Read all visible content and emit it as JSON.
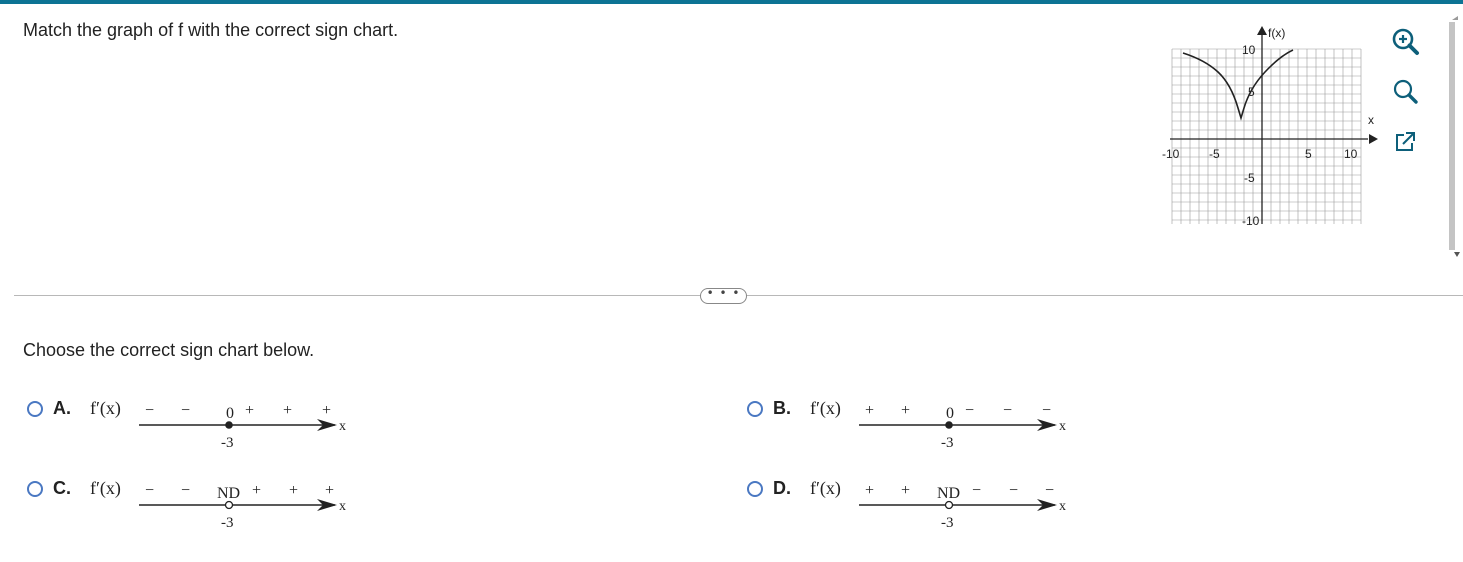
{
  "question_text": "Match the graph of f with the correct sign chart.",
  "prompt_text": "Choose the correct sign chart below.",
  "more_button_label": "• • •",
  "graph": {
    "y_axis_label": "f(x)",
    "x_axis_label": "x",
    "x_ticks": [
      "-10",
      "-5",
      "5",
      "10"
    ],
    "y_ticks": [
      "10",
      "5",
      "-5",
      "-10"
    ]
  },
  "tools": {
    "zoom_in_icon": "zoom-in-icon",
    "zoom_out_icon": "zoom-out-icon",
    "popout_icon": "external-link-icon"
  },
  "fprime_label": "f′(x)",
  "choices": [
    {
      "letter": "A.",
      "critical_label": "0",
      "point": "-3",
      "axis": "x",
      "signs_left": [
        "−",
        "−"
      ],
      "signs_right": [
        "+",
        "+",
        "+"
      ]
    },
    {
      "letter": "B.",
      "critical_label": "0",
      "point": "-3",
      "axis": "x",
      "signs_left": [
        "+",
        "+"
      ],
      "signs_right": [
        "−",
        "−",
        "−"
      ]
    },
    {
      "letter": "C.",
      "critical_label": "ND",
      "point": "-3",
      "axis": "x",
      "signs_left": [
        "−",
        "−"
      ],
      "signs_right": [
        "+",
        "+",
        "+"
      ]
    },
    {
      "letter": "D.",
      "critical_label": "ND",
      "point": "-3",
      "axis": "x",
      "signs_left": [
        "+",
        "+"
      ],
      "signs_right": [
        "−",
        "−",
        "−"
      ]
    }
  ]
}
